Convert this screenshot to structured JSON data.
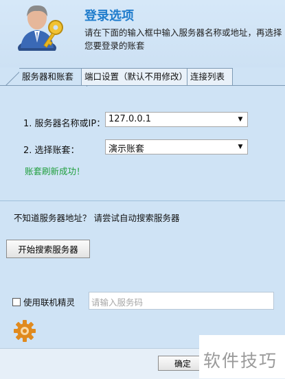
{
  "header": {
    "title": "登录选项",
    "description": "请在下面的输入框中输入服务器名称或地址，再选择您要登录的账套"
  },
  "tabs": [
    {
      "label": "服务器和账套"
    },
    {
      "label": "端口设置（默认不用修改）"
    },
    {
      "label": "连接列表"
    }
  ],
  "form": {
    "server_label": "1. 服务器名称或IP：",
    "server_value": "127.0.0.1",
    "account_label": "2. 选择账套：",
    "account_value": "演示账套",
    "status": "账套刷新成功！"
  },
  "search": {
    "hint": "不知道服务器地址？ 请尝试自动搜索服务器",
    "button": "开始搜索服务器"
  },
  "online": {
    "checkbox_label": "使用联机精灵",
    "placeholder": "请输入服务码"
  },
  "footer": {
    "ok_label": "确定"
  },
  "watermark": "软件技巧",
  "colors": {
    "title": "#1f7ccc",
    "status": "#1f9e3c",
    "background": "#cfe3f5"
  }
}
